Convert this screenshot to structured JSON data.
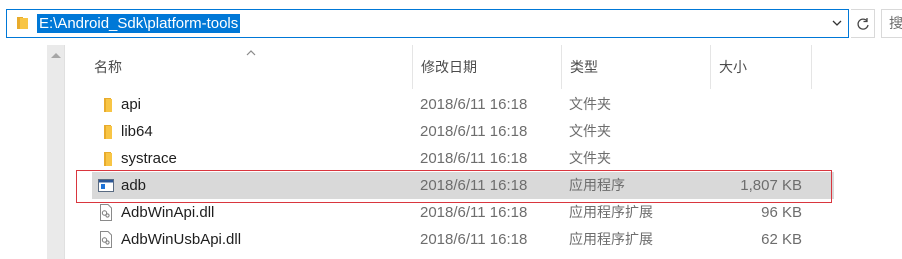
{
  "address_bar": {
    "path": "E:\\Android_Sdk\\platform-tools"
  },
  "search": {
    "placeholder": "搜"
  },
  "columns": {
    "name": "名称",
    "date_modified": "修改日期",
    "type": "类型",
    "size": "大小"
  },
  "files": [
    {
      "name": "api",
      "date": "2018/6/11 16:18",
      "type": "文件夹",
      "size": "",
      "icon": "folder-icon"
    },
    {
      "name": "lib64",
      "date": "2018/6/11 16:18",
      "type": "文件夹",
      "size": "",
      "icon": "folder-icon"
    },
    {
      "name": "systrace",
      "date": "2018/6/11 16:18",
      "type": "文件夹",
      "size": "",
      "icon": "folder-icon"
    },
    {
      "name": "adb",
      "date": "2018/6/11 16:18",
      "type": "应用程序",
      "size": "1,807 KB",
      "icon": "application-icon",
      "selected": true
    },
    {
      "name": "AdbWinApi.dll",
      "date": "2018/6/11 16:18",
      "type": "应用程序扩展",
      "size": "96 KB",
      "icon": "dll-file-icon"
    },
    {
      "name": "AdbWinUsbApi.dll",
      "date": "2018/6/11 16:18",
      "type": "应用程序扩展",
      "size": "62 KB",
      "icon": "dll-file-icon"
    }
  ],
  "colors": {
    "accent": "#0078d7",
    "selected_row": "#d9d9d9",
    "annotation_box": "#d9363e",
    "folder": "#f8c545"
  }
}
